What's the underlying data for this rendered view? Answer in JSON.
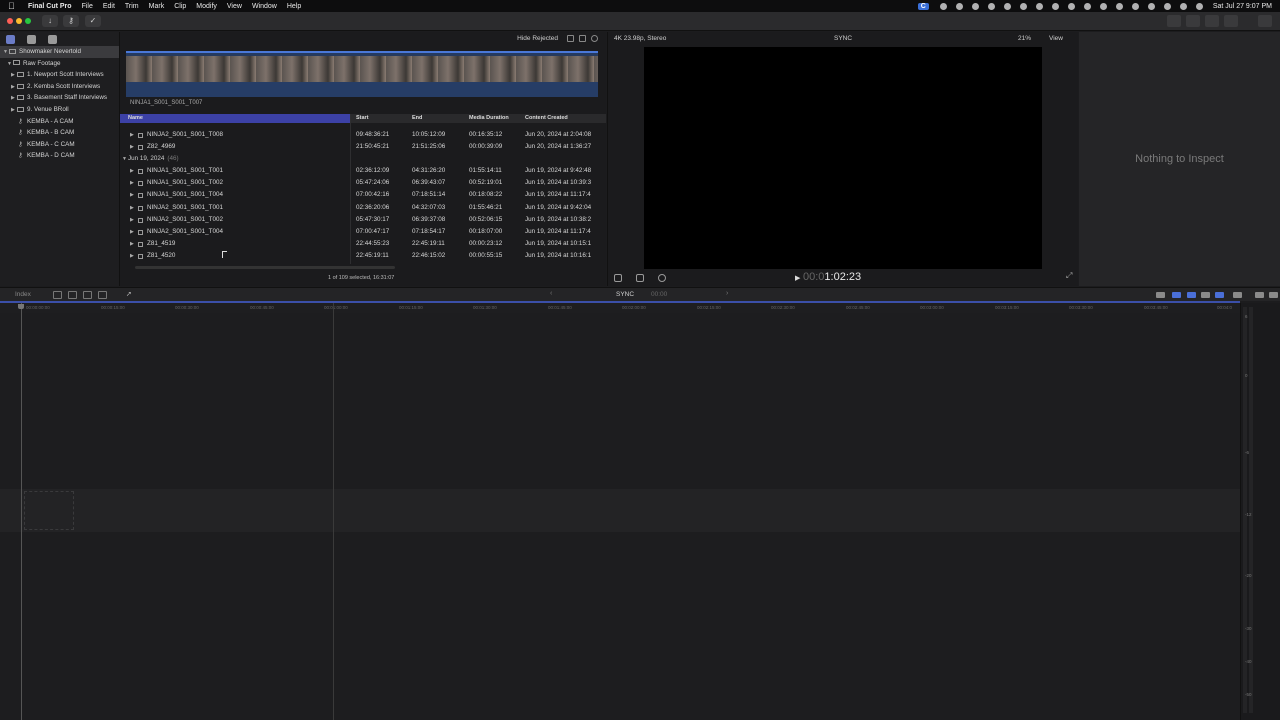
{
  "menubar": {
    "items": [
      "Final Cut Pro",
      "File",
      "Edit",
      "Trim",
      "Mark",
      "Clip",
      "Modify",
      "View",
      "Window",
      "Help"
    ],
    "badge": "C",
    "clock": "Sat Jul 27  9:07 PM"
  },
  "libraries": {
    "items": [
      {
        "label": "Showmaker Nevertold",
        "kind": "library",
        "selected": true
      },
      {
        "label": "Raw Footage",
        "kind": "event"
      },
      {
        "label": "1. Newport Scott Interviews",
        "kind": "folder"
      },
      {
        "label": "2. Kemba Scott Interviews",
        "kind": "folder"
      },
      {
        "label": "3. Basement Staff Interviews",
        "kind": "folder"
      },
      {
        "label": "9. Venue BRoll",
        "kind": "folder"
      },
      {
        "label": "KEMBA - A CAM",
        "kind": "keyword"
      },
      {
        "label": "KEMBA - B CAM",
        "kind": "keyword"
      },
      {
        "label": "KEMBA - C CAM",
        "kind": "keyword"
      },
      {
        "label": "KEMBA - D CAM",
        "kind": "keyword"
      }
    ]
  },
  "browser": {
    "hide_rejected": "Hide Rejected",
    "clip_label": "NINJA1_S001_S001_T007",
    "columns": [
      "Name",
      "Start",
      "End",
      "Media Duration",
      "Content Created"
    ],
    "rows": [
      {
        "type": "clip",
        "name": "NINJA2_S001_S001_T008",
        "start": "09:48:36:21",
        "end": "10:05:12:09",
        "dur": "00:16:35:12",
        "created": "Jun 20, 2024 at 2:04:08"
      },
      {
        "type": "clip",
        "name": "Z82_4969",
        "start": "21:50:45:21",
        "end": "21:51:25:06",
        "dur": "00:00:39:09",
        "created": "Jun 20, 2024 at 1:36:27"
      },
      {
        "type": "group",
        "name": "Jun 19, 2024",
        "count": "(46)"
      },
      {
        "type": "clip",
        "name": "NINJA1_S001_S001_T001",
        "start": "02:36:12:09",
        "end": "04:31:26:20",
        "dur": "01:55:14:11",
        "created": "Jun 19, 2024 at 9:42:48"
      },
      {
        "type": "clip",
        "name": "NINJA1_S001_S001_T002",
        "start": "05:47:24:06",
        "end": "06:39:43:07",
        "dur": "00:52:19:01",
        "created": "Jun 19, 2024 at 10:39:3"
      },
      {
        "type": "clip",
        "name": "NINJA1_S001_S001_T004",
        "start": "07:00:42:16",
        "end": "07:18:51:14",
        "dur": "00:18:08:22",
        "created": "Jun 19, 2024 at 11:17:4"
      },
      {
        "type": "clip",
        "name": "NINJA2_S001_S001_T001",
        "start": "02:36:20:06",
        "end": "04:32:07:03",
        "dur": "01:55:46:21",
        "created": "Jun 19, 2024 at 9:42:04"
      },
      {
        "type": "clip",
        "name": "NINJA2_S001_S001_T002",
        "start": "05:47:30:17",
        "end": "06:39:37:08",
        "dur": "00:52:06:15",
        "created": "Jun 19, 2024 at 10:38:2"
      },
      {
        "type": "clip",
        "name": "NINJA2_S001_S001_T004",
        "start": "07:00:47:17",
        "end": "07:18:54:17",
        "dur": "00:18:07:00",
        "created": "Jun 19, 2024 at 11:17:4"
      },
      {
        "type": "clip",
        "name": "Z81_4519",
        "start": "22:44:55:23",
        "end": "22:45:19:11",
        "dur": "00:00:23:12",
        "created": "Jun 19, 2024 at 10:15:1"
      },
      {
        "type": "clip",
        "name": "Z81_4520",
        "start": "22:45:19:11",
        "end": "22:46:15:02",
        "dur": "00:00:55:15",
        "created": "Jun 19, 2024 at 10:16:1"
      }
    ],
    "status": "1 of 109 selected, 16:31:07"
  },
  "viewer": {
    "format": "4K 23.98p, Stereo",
    "sync": "SYNC",
    "zoom": "21%",
    "view": "View",
    "timecode_dim": "00:0",
    "timecode": "1:02:23"
  },
  "inspector": {
    "empty": "Nothing to Inspect"
  },
  "timeline": {
    "index": "Index",
    "project": "SYNC",
    "tc": "00:00",
    "ruler": [
      "00:00:00:00",
      "00:00:15:00",
      "00:00:30:00",
      "00:00:45:00",
      "00:01:00:00",
      "00:01:15:00",
      "00:01:30:00",
      "00:01:45:00",
      "00:02:00:00",
      "00:02:15:00",
      "00:02:30:00",
      "00:02:45:00",
      "00:03:00:00",
      "00:03:15:00",
      "00:03:30:00",
      "00:03:45:00",
      "00:04:0"
    ],
    "meter_labels": [
      "6",
      "0",
      "-6",
      "-12",
      "-20",
      "-30",
      "-40",
      "-50"
    ]
  },
  "colors": {
    "accent": "#3c41a6",
    "video_bg": "#000000",
    "panel": "#1b1b1d"
  }
}
